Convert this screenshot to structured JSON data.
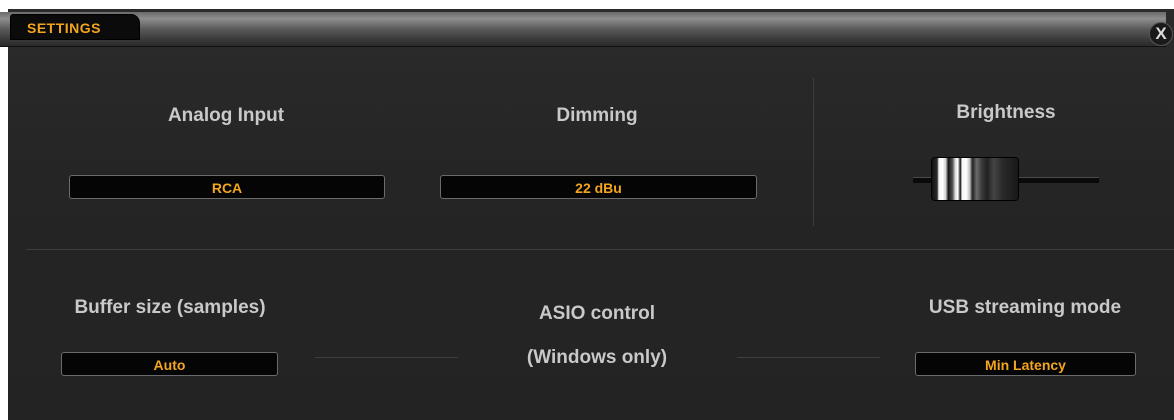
{
  "window": {
    "title": "SETTINGS",
    "close_label": "X"
  },
  "analog_input": {
    "label": "Analog Input",
    "value": "RCA"
  },
  "dimming": {
    "label": "Dimming",
    "value": "22 dBu"
  },
  "brightness": {
    "label": "Brightness",
    "level": 0.1
  },
  "buffer_size": {
    "label": "Buffer size (samples)",
    "value": "Auto"
  },
  "asio_control": {
    "line1": "ASIO control",
    "line2": "(Windows only)"
  },
  "usb_streaming_mode": {
    "label": "USB streaming mode",
    "value": "Min Latency"
  },
  "colors": {
    "accent": "#f3a51f",
    "panel_bg": "#262626",
    "label_text": "#c9c9c9"
  }
}
